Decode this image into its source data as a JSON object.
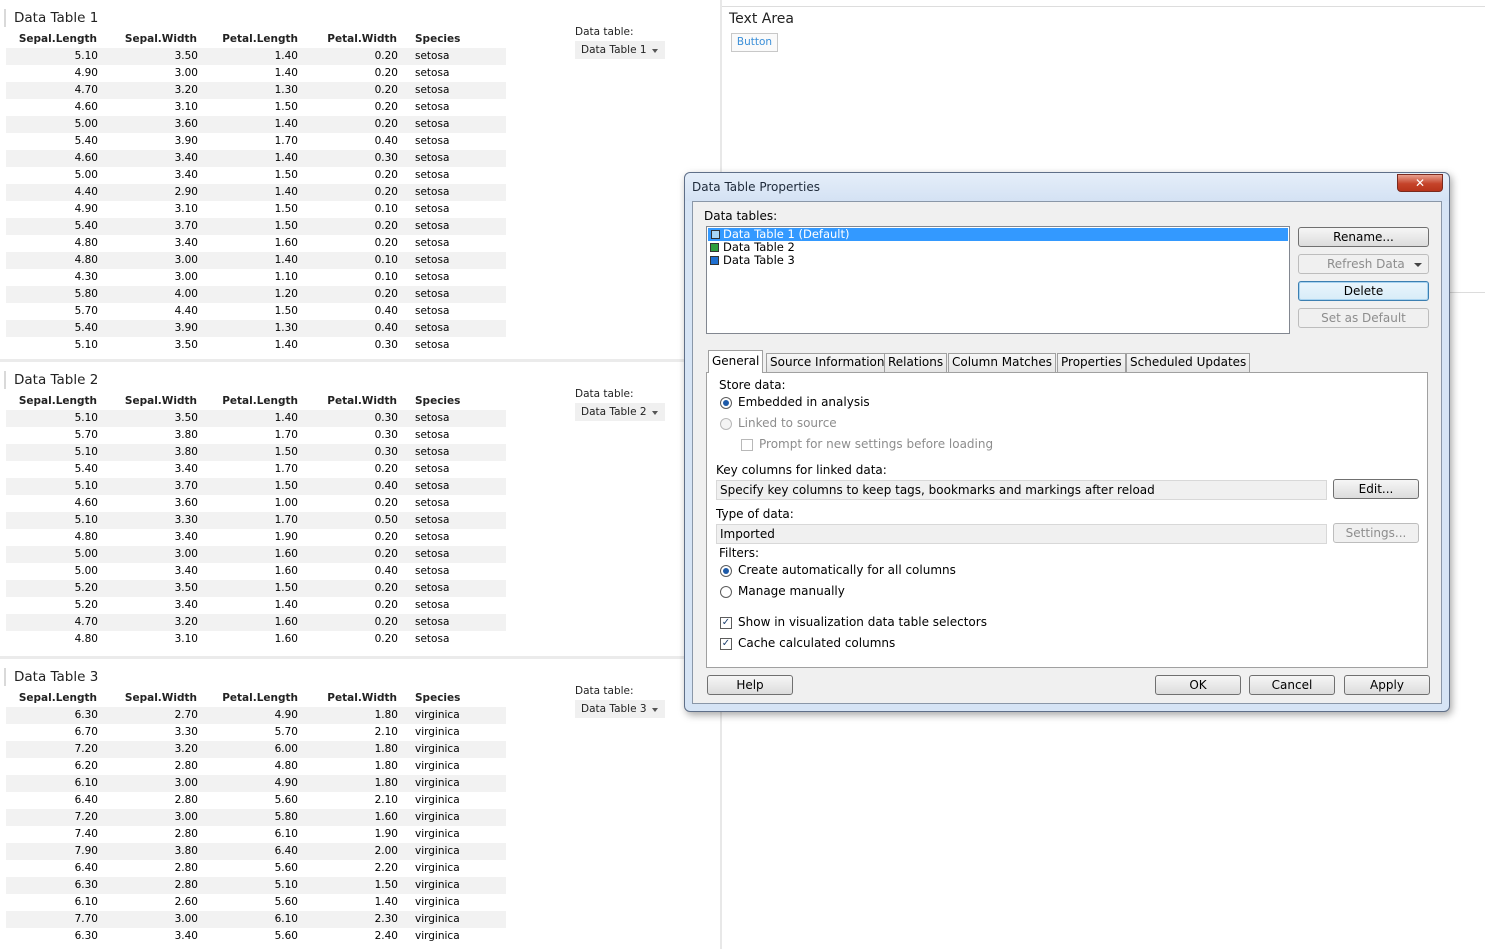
{
  "table_columns": [
    "Sepal.Length",
    "Sepal.Width",
    "Petal.Length",
    "Petal.Width",
    "Species"
  ],
  "selector_label": "Data table:",
  "tables": [
    {
      "title": "Data Table 1",
      "selected": "Data Table 1",
      "rows": [
        [
          "5.10",
          "3.50",
          "1.40",
          "0.20",
          "setosa"
        ],
        [
          "4.90",
          "3.00",
          "1.40",
          "0.20",
          "setosa"
        ],
        [
          "4.70",
          "3.20",
          "1.30",
          "0.20",
          "setosa"
        ],
        [
          "4.60",
          "3.10",
          "1.50",
          "0.20",
          "setosa"
        ],
        [
          "5.00",
          "3.60",
          "1.40",
          "0.20",
          "setosa"
        ],
        [
          "5.40",
          "3.90",
          "1.70",
          "0.40",
          "setosa"
        ],
        [
          "4.60",
          "3.40",
          "1.40",
          "0.30",
          "setosa"
        ],
        [
          "5.00",
          "3.40",
          "1.50",
          "0.20",
          "setosa"
        ],
        [
          "4.40",
          "2.90",
          "1.40",
          "0.20",
          "setosa"
        ],
        [
          "4.90",
          "3.10",
          "1.50",
          "0.10",
          "setosa"
        ],
        [
          "5.40",
          "3.70",
          "1.50",
          "0.20",
          "setosa"
        ],
        [
          "4.80",
          "3.40",
          "1.60",
          "0.20",
          "setosa"
        ],
        [
          "4.80",
          "3.00",
          "1.40",
          "0.10",
          "setosa"
        ],
        [
          "4.30",
          "3.00",
          "1.10",
          "0.10",
          "setosa"
        ],
        [
          "5.80",
          "4.00",
          "1.20",
          "0.20",
          "setosa"
        ],
        [
          "5.70",
          "4.40",
          "1.50",
          "0.40",
          "setosa"
        ],
        [
          "5.40",
          "3.90",
          "1.30",
          "0.40",
          "setosa"
        ],
        [
          "5.10",
          "3.50",
          "1.40",
          "0.30",
          "setosa"
        ]
      ]
    },
    {
      "title": "Data Table 2",
      "selected": "Data Table 2",
      "rows": [
        [
          "5.10",
          "3.50",
          "1.40",
          "0.30",
          "setosa"
        ],
        [
          "5.70",
          "3.80",
          "1.70",
          "0.30",
          "setosa"
        ],
        [
          "5.10",
          "3.80",
          "1.50",
          "0.30",
          "setosa"
        ],
        [
          "5.40",
          "3.40",
          "1.70",
          "0.20",
          "setosa"
        ],
        [
          "5.10",
          "3.70",
          "1.50",
          "0.40",
          "setosa"
        ],
        [
          "4.60",
          "3.60",
          "1.00",
          "0.20",
          "setosa"
        ],
        [
          "5.10",
          "3.30",
          "1.70",
          "0.50",
          "setosa"
        ],
        [
          "4.80",
          "3.40",
          "1.90",
          "0.20",
          "setosa"
        ],
        [
          "5.00",
          "3.00",
          "1.60",
          "0.20",
          "setosa"
        ],
        [
          "5.00",
          "3.40",
          "1.60",
          "0.40",
          "setosa"
        ],
        [
          "5.20",
          "3.50",
          "1.50",
          "0.20",
          "setosa"
        ],
        [
          "5.20",
          "3.40",
          "1.40",
          "0.20",
          "setosa"
        ],
        [
          "4.70",
          "3.20",
          "1.60",
          "0.20",
          "setosa"
        ],
        [
          "4.80",
          "3.10",
          "1.60",
          "0.20",
          "setosa"
        ]
      ]
    },
    {
      "title": "Data Table 3",
      "selected": "Data Table 3",
      "rows": [
        [
          "6.30",
          "2.70",
          "4.90",
          "1.80",
          "virginica"
        ],
        [
          "6.70",
          "3.30",
          "5.70",
          "2.10",
          "virginica"
        ],
        [
          "7.20",
          "3.20",
          "6.00",
          "1.80",
          "virginica"
        ],
        [
          "6.20",
          "2.80",
          "4.80",
          "1.80",
          "virginica"
        ],
        [
          "6.10",
          "3.00",
          "4.90",
          "1.80",
          "virginica"
        ],
        [
          "6.40",
          "2.80",
          "5.60",
          "2.10",
          "virginica"
        ],
        [
          "7.20",
          "3.00",
          "5.80",
          "1.60",
          "virginica"
        ],
        [
          "7.40",
          "2.80",
          "6.10",
          "1.90",
          "virginica"
        ],
        [
          "7.90",
          "3.80",
          "6.40",
          "2.00",
          "virginica"
        ],
        [
          "6.40",
          "2.80",
          "5.60",
          "2.20",
          "virginica"
        ],
        [
          "6.30",
          "2.80",
          "5.10",
          "1.50",
          "virginica"
        ],
        [
          "6.10",
          "2.60",
          "5.60",
          "1.40",
          "virginica"
        ],
        [
          "7.70",
          "3.00",
          "6.10",
          "2.30",
          "virginica"
        ],
        [
          "6.30",
          "3.40",
          "5.60",
          "2.40",
          "virginica"
        ]
      ]
    }
  ],
  "text_area": {
    "title": "Text Area",
    "button_label": "Button"
  },
  "dialog": {
    "title": "Data Table Properties",
    "close_glyph": "✕",
    "list_label": "Data tables:",
    "list_items": [
      {
        "label": "Data Table 1 (Default)",
        "color": "#a9d6f5",
        "selected": true
      },
      {
        "label": "Data Table 2",
        "color": "#2e9e3e",
        "selected": false
      },
      {
        "label": "Data Table 3",
        "color": "#1f6fd0",
        "selected": false
      }
    ],
    "buttons": {
      "rename": "Rename...",
      "refresh": "Refresh Data",
      "delete": "Delete",
      "set_default": "Set as Default"
    },
    "tabs": [
      "General",
      "Source Information",
      "Relations",
      "Column Matches",
      "Properties",
      "Scheduled Updates"
    ],
    "general": {
      "store_data_label": "Store data:",
      "embedded": "Embedded in analysis",
      "linked": "Linked to source",
      "prompt": "Prompt for new settings before loading",
      "key_columns_label": "Key columns for linked data:",
      "key_columns_value": "Specify key columns to keep tags, bookmarks and markings after reload",
      "edit_button": "Edit...",
      "type_label": "Type of data:",
      "type_value": "Imported",
      "settings_button": "Settings...",
      "filters_label": "Filters:",
      "filter_auto": "Create automatically for all columns",
      "filter_manual": "Manage manually",
      "show_in_selectors": "Show in visualization data table selectors",
      "cache_columns": "Cache calculated columns",
      "check_glyph": "✓"
    },
    "footer": {
      "help": "Help",
      "ok": "OK",
      "cancel": "Cancel",
      "apply": "Apply"
    }
  }
}
